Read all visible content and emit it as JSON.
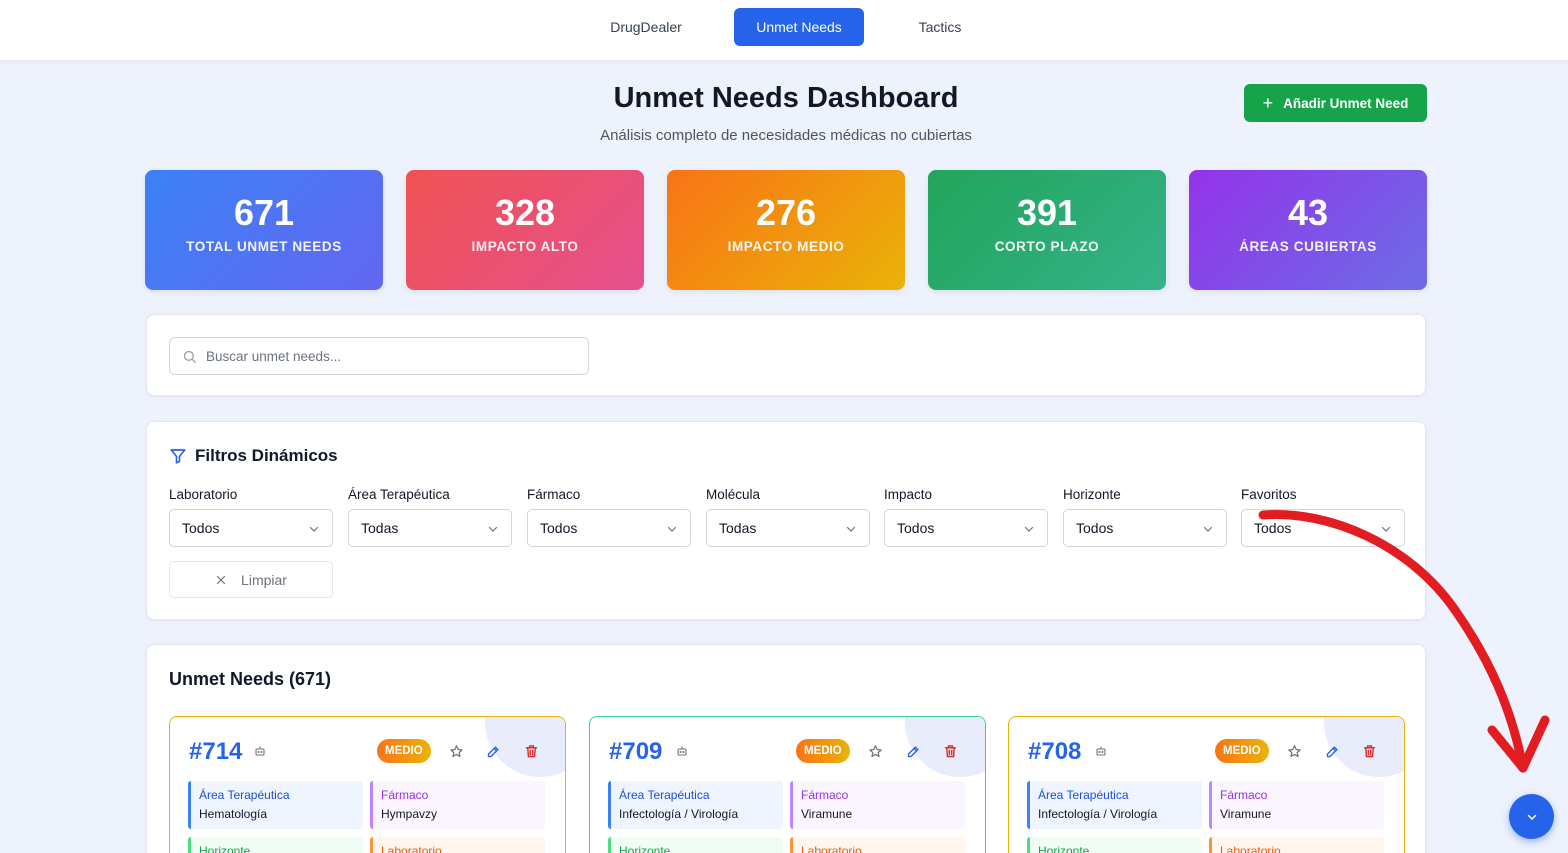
{
  "nav": {
    "items": [
      {
        "label": "DrugDealer"
      },
      {
        "label": "Unmet Needs"
      },
      {
        "label": "Tactics"
      }
    ]
  },
  "header": {
    "title": "Unmet Needs Dashboard",
    "subtitle": "Análisis completo de necesidades médicas no cubiertas",
    "add_button": "Añadir Unmet Need"
  },
  "stats": [
    {
      "value": "671",
      "label": "TOTAL UNMET NEEDS",
      "colors": [
        "#3b82f6",
        "#6366f1"
      ]
    },
    {
      "value": "328",
      "label": "IMPACTO ALTO",
      "colors": [
        "#f05252",
        "#e5508e"
      ]
    },
    {
      "value": "276",
      "label": "IMPACTO MEDIO",
      "colors": [
        "#f97316",
        "#eab308"
      ]
    },
    {
      "value": "391",
      "label": "CORTO PLAZO",
      "colors": [
        "#22a45a",
        "#34b38a"
      ]
    },
    {
      "value": "43",
      "label": "ÁREAS CUBIERTAS",
      "colors": [
        "#9333ea",
        "#6d6ce6"
      ]
    }
  ],
  "search": {
    "placeholder": "Buscar unmet needs..."
  },
  "filters": {
    "title": "Filtros Dinámicos",
    "items": [
      {
        "label": "Laboratorio",
        "value": "Todos"
      },
      {
        "label": "Área Terapéutica",
        "value": "Todas"
      },
      {
        "label": "Fármaco",
        "value": "Todos"
      },
      {
        "label": "Molécula",
        "value": "Todas"
      },
      {
        "label": "Impacto",
        "value": "Todos"
      },
      {
        "label": "Horizonte",
        "value": "Todos"
      },
      {
        "label": "Favoritos",
        "value": "Todos"
      }
    ],
    "clear_label": "Limpiar"
  },
  "needs": {
    "title": "Unmet Needs (671)",
    "cards": [
      {
        "id": "#714",
        "impact": "MEDIO",
        "border_color": "#eab308",
        "area_label": "Área Terapéutica",
        "area": "Hematología",
        "drug_label": "Fármaco",
        "drug": "Hympavzy",
        "horizon_label": "Horizonte",
        "lab_label": "Laboratorio"
      },
      {
        "id": "#709",
        "impact": "MEDIO",
        "border_color": "#34d399",
        "area_label": "Área Terapéutica",
        "area": "Infectología / Virología",
        "drug_label": "Fármaco",
        "drug": "Viramune",
        "horizon_label": "Horizonte",
        "lab_label": "Laboratorio"
      },
      {
        "id": "#708",
        "impact": "MEDIO",
        "border_color": "#eab308",
        "area_label": "Área Terapéutica",
        "area": "Infectología / Virología",
        "drug_label": "Fármaco",
        "drug": "Viramune",
        "horizon_label": "Horizonte",
        "lab_label": "Laboratorio"
      }
    ]
  },
  "annotation": {
    "color": "#e11d22"
  },
  "colors": {
    "accent": "#2563eb",
    "success": "#16a34a"
  }
}
